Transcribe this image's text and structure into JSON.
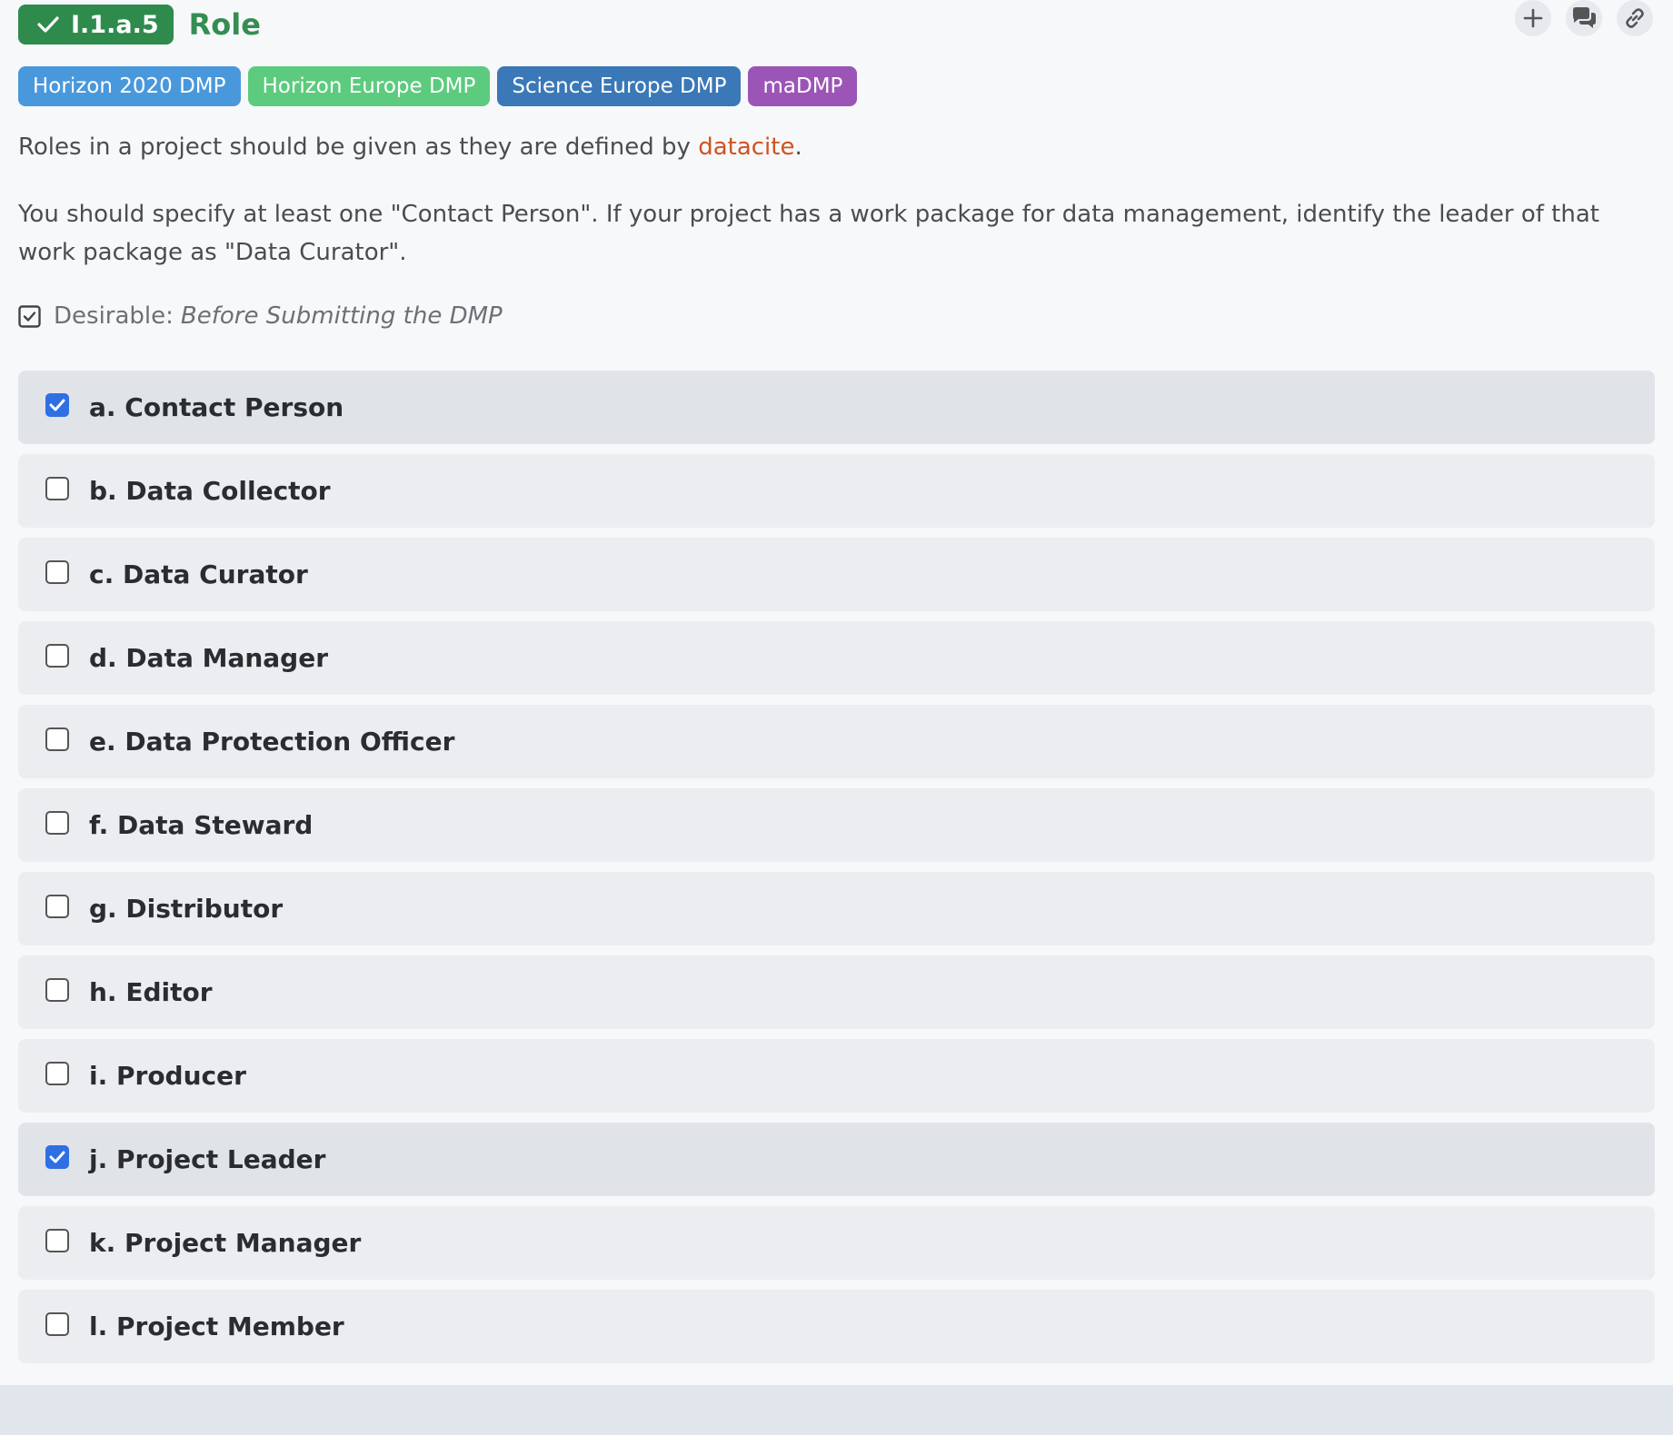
{
  "question": {
    "code": "I.1.a.5",
    "title": "Role"
  },
  "actions": [
    {
      "name": "add-icon"
    },
    {
      "name": "comments-icon"
    },
    {
      "name": "link-icon"
    }
  ],
  "tags": [
    {
      "label": "Horizon 2020 DMP",
      "color": "#4a98dc"
    },
    {
      "label": "Horizon Europe DMP",
      "color": "#5ccb7e"
    },
    {
      "label": "Science Europe DMP",
      "color": "#3a78b7"
    },
    {
      "label": "maDMP",
      "color": "#9b55b7"
    }
  ],
  "description": {
    "line1_before": "Roles in a project should be given as they are defined by ",
    "line1_link": "datacite",
    "line1_after": ".",
    "line2": "You should specify at least one \"Contact Person\". If your project has a work package for data management, identify the leader of that work package as \"Data Curator\"."
  },
  "desirable": {
    "label": "Desirable:",
    "phase": "Before Submitting the DMP"
  },
  "options": [
    {
      "label": "a. Contact Person",
      "checked": true
    },
    {
      "label": "b. Data Collector",
      "checked": false
    },
    {
      "label": "c. Data Curator",
      "checked": false
    },
    {
      "label": "d. Data Manager",
      "checked": false
    },
    {
      "label": "e. Data Protection Officer",
      "checked": false
    },
    {
      "label": "f. Data Steward",
      "checked": false
    },
    {
      "label": "g. Distributor",
      "checked": false
    },
    {
      "label": "h. Editor",
      "checked": false
    },
    {
      "label": "i. Producer",
      "checked": false
    },
    {
      "label": "j. Project Leader",
      "checked": true
    },
    {
      "label": "k. Project Manager",
      "checked": false
    },
    {
      "label": "l. Project Member",
      "checked": false
    }
  ]
}
